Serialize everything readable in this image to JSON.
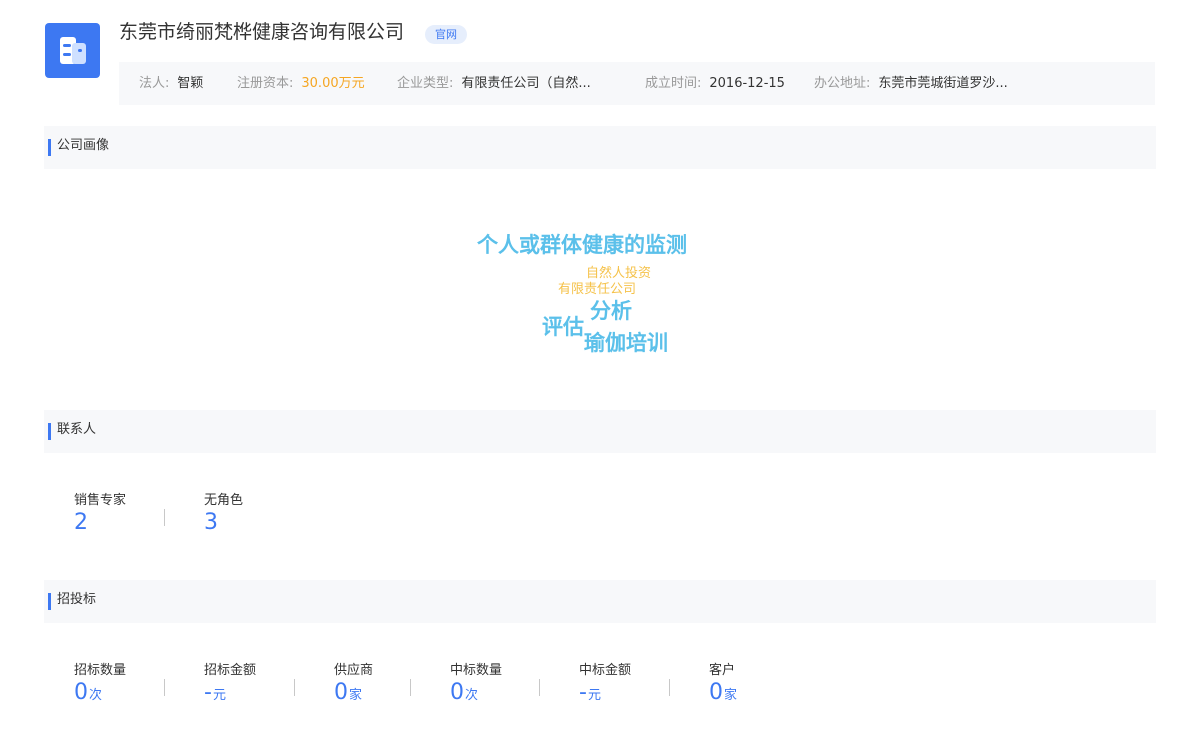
{
  "company": {
    "name": "东莞市绮丽梵桦健康咨询有限公司",
    "official_tag": "官网"
  },
  "info": {
    "legal_label": "法人:",
    "legal_value": "智颖",
    "capital_label": "注册资本:",
    "capital_value": "30.00万元",
    "type_label": "企业类型:",
    "type_value": "有限责任公司（自然...",
    "founded_label": "成立时间:",
    "founded_value": "2016-12-15",
    "address_label": "办公地址:",
    "address_value": "东莞市莞城街道罗沙..."
  },
  "colors": {
    "accent": "#3d78f2",
    "cloud_blue": "#5bc0ea",
    "cloud_orange": "#f5c24a",
    "capital": "#f5a623"
  },
  "sections": {
    "profile": "公司画像",
    "contacts": "联系人",
    "bidding": "招投标"
  },
  "word_cloud": [
    {
      "text": "个人或群体健康的监测",
      "color": "#5bc0ea"
    },
    {
      "text": "自然人投资",
      "color": "#f5c24a"
    },
    {
      "text": "有限责任公司",
      "color": "#f5c24a"
    },
    {
      "text": "分析",
      "color": "#5bc0ea"
    },
    {
      "text": "评估",
      "color": "#5bc0ea"
    },
    {
      "text": "瑜伽培训",
      "color": "#5bc0ea"
    }
  ],
  "contacts": [
    {
      "label": "销售专家",
      "value": "2"
    },
    {
      "label": "无角色",
      "value": "3"
    }
  ],
  "bidding": [
    {
      "label": "招标数量",
      "value": "0",
      "unit": "次"
    },
    {
      "label": "招标金额",
      "value": "-",
      "unit": "元"
    },
    {
      "label": "供应商",
      "value": "0",
      "unit": "家"
    },
    {
      "label": "中标数量",
      "value": "0",
      "unit": "次"
    },
    {
      "label": "中标金额",
      "value": "-",
      "unit": "元"
    },
    {
      "label": "客户",
      "value": "0",
      "unit": "家"
    }
  ]
}
